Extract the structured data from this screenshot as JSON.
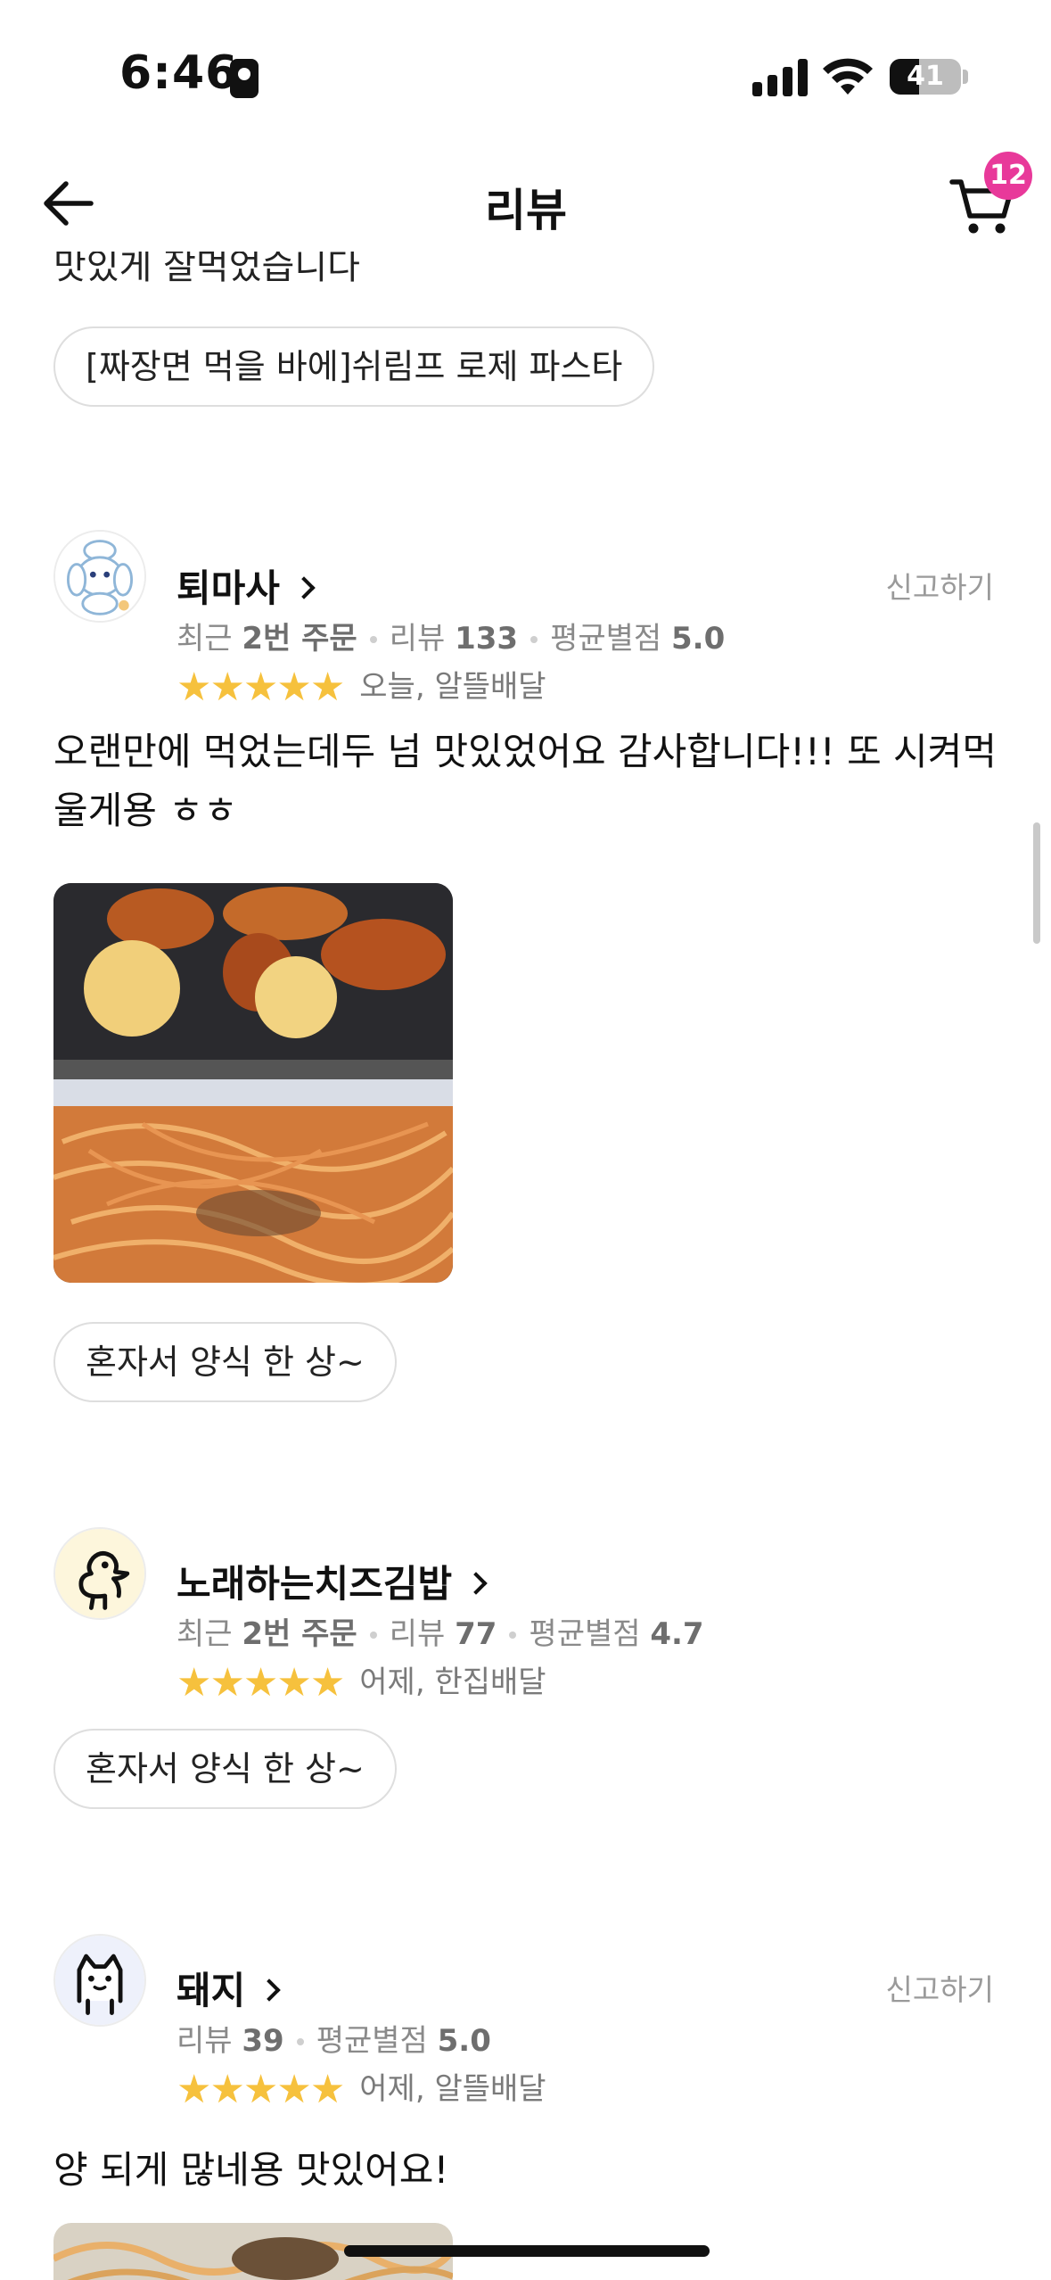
{
  "status_bar": {
    "time": "6:46",
    "battery": "41",
    "battery_level": 0.41
  },
  "header": {
    "title": "리뷰",
    "cart_badge": "12"
  },
  "partial_review": {
    "text": "맛있게 잘먹었습니다",
    "menu_chip": "[짜장면 먹을 바에]쉬림프 로제 파스타"
  },
  "reviews": [
    {
      "nickname": "퇴마사",
      "report": "신고하기",
      "stats": {
        "recent_prefix": "최근",
        "recent_value": "2번 주문",
        "review_label": "리뷰",
        "review_count": "133",
        "avg_label": "평균별점",
        "avg_value": "5.0"
      },
      "rating": 5,
      "meta": "오늘, 알뜰배달",
      "text": "오랜만에 먹었는데두 넘 맛있었어요 감사합니다!!! 또 시켜먹울게용 ㅎㅎ",
      "menu_chip": "혼자서 양식 한 상~",
      "avatar_icon": "chef-puppy-avatar-icon"
    },
    {
      "nickname": "노래하는치즈김밥",
      "stats": {
        "recent_prefix": "최근",
        "recent_value": "2번 주문",
        "review_label": "리뷰",
        "review_count": "77",
        "avg_label": "평균별점",
        "avg_value": "4.7"
      },
      "rating": 5,
      "meta": "어제, 한집배달",
      "menu_chip": "혼자서 양식 한 상~",
      "avatar_icon": "duck-avatar-icon"
    },
    {
      "nickname": "돼지",
      "report": "신고하기",
      "stats": {
        "review_label": "리뷰",
        "review_count": "39",
        "avg_label": "평균별점",
        "avg_value": "5.0"
      },
      "rating": 5,
      "meta": "어제, 알뜰배달",
      "text": "양 되게 많네용 맛있어요!",
      "avatar_icon": "cat-avatar-icon"
    }
  ],
  "colors": {
    "accent_badge": "#e8399a",
    "star": "#f6c13d",
    "muted_text": "#8a8a8a"
  }
}
